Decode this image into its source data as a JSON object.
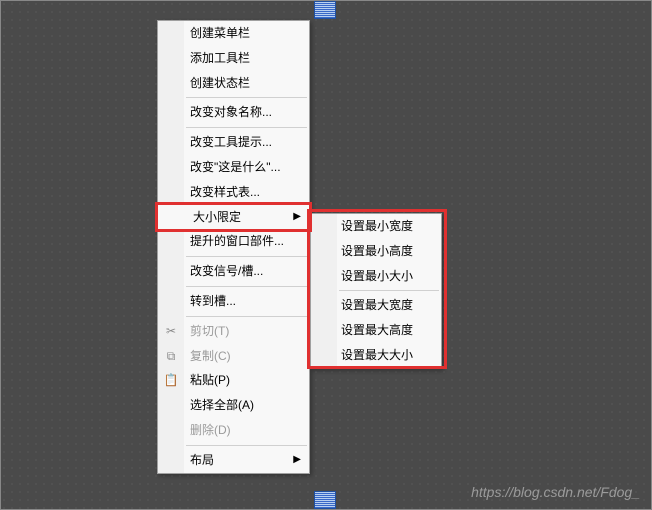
{
  "highlight_color": "#e03030",
  "main_menu": {
    "items": [
      {
        "label": "创建菜单栏"
      },
      {
        "label": "添加工具栏"
      },
      {
        "label": "创建状态栏"
      },
      {
        "label": "改变对象名称..."
      },
      {
        "label": "改变工具提示..."
      },
      {
        "label": "改变\"这是什么\"..."
      },
      {
        "label": "改变样式表..."
      },
      {
        "label": "大小限定",
        "has_submenu": true,
        "highlighted": true
      },
      {
        "label": "提升的窗口部件..."
      },
      {
        "label": "改变信号/槽..."
      },
      {
        "label": "转到槽..."
      },
      {
        "label": "剪切(T)",
        "icon": "cut",
        "disabled": true,
        "shortcut_char": "T"
      },
      {
        "label": "复制(C)",
        "icon": "copy",
        "disabled": true,
        "shortcut_char": "C"
      },
      {
        "label": "粘贴(P)",
        "icon": "paste",
        "shortcut_char": "P"
      },
      {
        "label": "选择全部(A)",
        "shortcut_char": "A"
      },
      {
        "label": "删除(D)",
        "disabled": true,
        "shortcut_char": "D"
      },
      {
        "label": "布局",
        "has_submenu": true
      }
    ]
  },
  "submenu": {
    "items": [
      {
        "label": "设置最小宽度"
      },
      {
        "label": "设置最小高度"
      },
      {
        "label": "设置最小大小"
      },
      {
        "label": "设置最大宽度"
      },
      {
        "label": "设置最大高度"
      },
      {
        "label": "设置最大大小"
      }
    ]
  },
  "watermark": "https://blog.csdn.net/Fdog_"
}
